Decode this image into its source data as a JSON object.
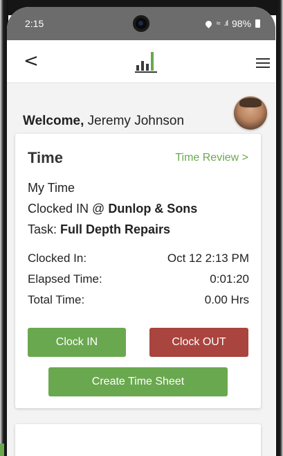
{
  "status_bar": {
    "time": "2:15",
    "battery": "98%",
    "icons": [
      "location-icon",
      "wifi-icon",
      "signal-icon",
      "battery-icon"
    ]
  },
  "app_bar": {
    "back_label": "<",
    "logo": "bar-chart-logo",
    "menu": "hamburger-menu-icon"
  },
  "welcome": {
    "greeting": "Welcome,",
    "user_name": "Jeremy Johnson"
  },
  "time_card": {
    "title": "Time",
    "review_link": "Time Review >",
    "my_time": "My Time",
    "clocked_prefix": "Clocked IN  @",
    "clocked_location": "Dunlop & Sons",
    "task_prefix": "Task:",
    "task_name": "Full Depth Repairs",
    "rows": [
      {
        "label": "Clocked In:",
        "value": "Oct 12 2:13 PM"
      },
      {
        "label": "Elapsed Time:",
        "value": "0:01:20"
      },
      {
        "label": "Total Time:",
        "value": "0.00 Hrs"
      }
    ],
    "clock_in_label": "Clock IN",
    "clock_out_label": "Clock OUT",
    "create_sheet_label": "Create Time Sheet"
  },
  "colors": {
    "accent_green": "#6aa84f",
    "clock_out_red": "#a9443f",
    "status_bar": "#6c6c6c"
  }
}
